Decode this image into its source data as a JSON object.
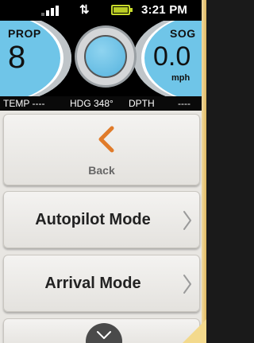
{
  "statusbar": {
    "signal_icon": "signal-strength-icon",
    "data_icon": "data-transfer-icon",
    "arrows_glyph": "⇅",
    "battery_icon": "battery-icon",
    "time": "3:21 PM"
  },
  "gauges": {
    "prop_label": "PROP",
    "prop_value": "8",
    "sog_label": "SOG",
    "sog_value": "0.0",
    "sog_unit": "mph",
    "compass_icon": "compass-icon",
    "accent_color": "#6fc5e8"
  },
  "infostrip": {
    "temp": "TEMP ----",
    "heading": "HDG 348°",
    "depth": "DPTH",
    "depth_value": "----"
  },
  "menu": {
    "back_label": "Back",
    "back_color": "#e07b2a",
    "items": [
      {
        "label": "Autopilot Mode"
      },
      {
        "label": "Arrival Mode"
      }
    ]
  }
}
